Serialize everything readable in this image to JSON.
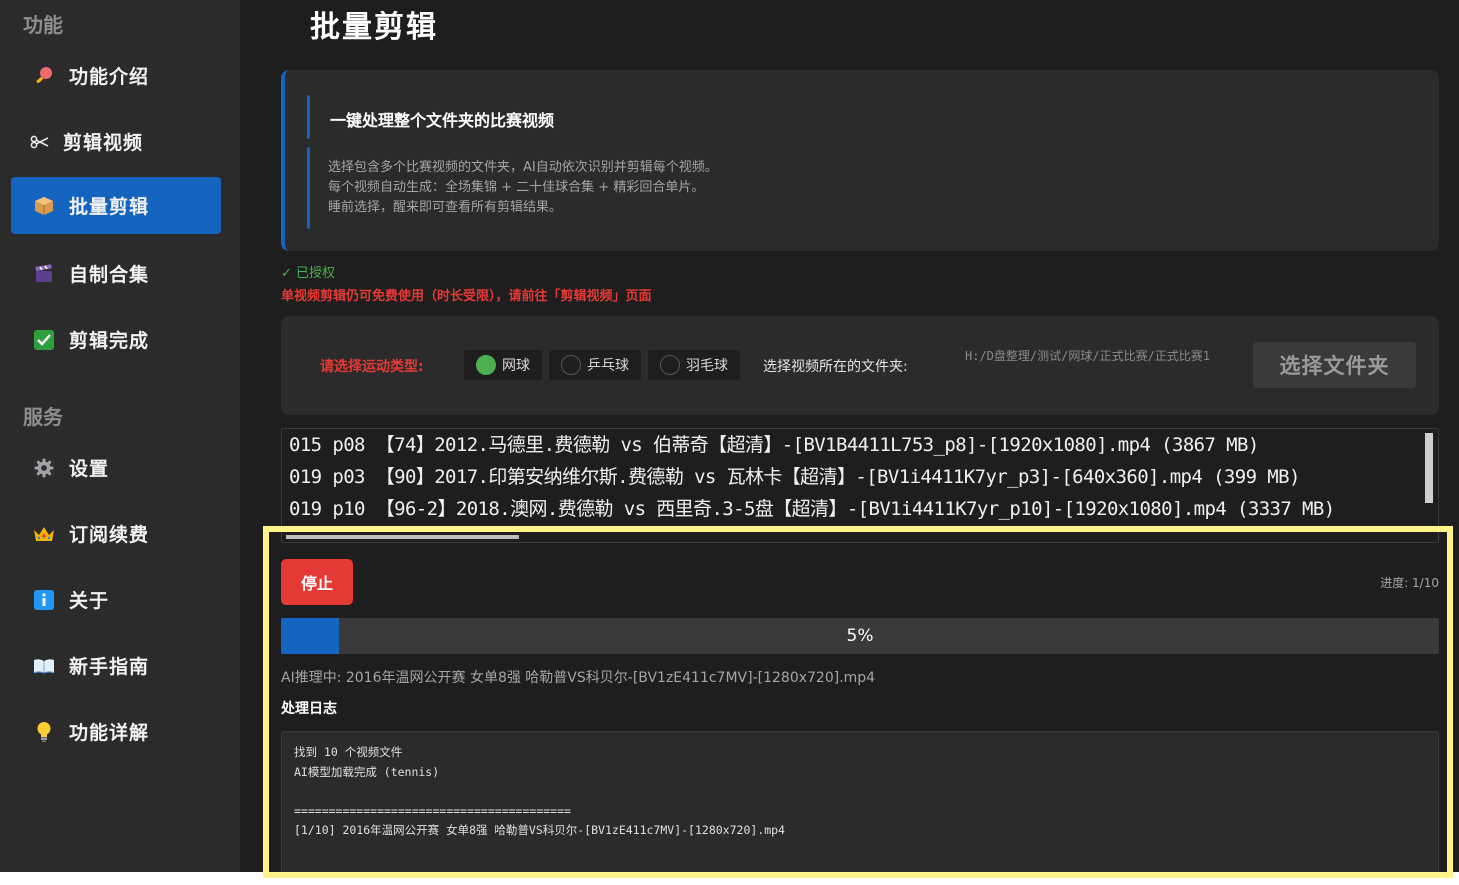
{
  "sidebar": {
    "sections": [
      {
        "title": "功能"
      },
      {
        "title": "服务"
      }
    ],
    "items": [
      {
        "label": "功能介绍",
        "icon": "pin-icon"
      },
      {
        "label": "剪辑视频",
        "icon": "scissors-icon"
      },
      {
        "label": "批量剪辑",
        "icon": "package-icon"
      },
      {
        "label": "自制合集",
        "icon": "clapperboard-icon"
      },
      {
        "label": "剪辑完成",
        "icon": "check-box-icon"
      },
      {
        "label": "设置",
        "icon": "gear-icon"
      },
      {
        "label": "订阅续费",
        "icon": "crown-icon"
      },
      {
        "label": "关于",
        "icon": "info-icon"
      },
      {
        "label": "新手指南",
        "icon": "book-icon"
      },
      {
        "label": "功能详解",
        "icon": "lightbulb-icon"
      }
    ]
  },
  "page": {
    "title": "批量剪辑"
  },
  "intro": {
    "heading": "一键处理整个文件夹的比赛视频",
    "lines": [
      "选择包含多个比赛视频的文件夹，AI自动依次识别并剪辑每个视频。",
      "每个视频自动生成：全场集锦 + 二十佳球合集 + 精彩回合单片。",
      "睡前选择，醒来即可查看所有剪辑结果。"
    ]
  },
  "auth": {
    "status": "✓  已授权",
    "warning": "单视频剪辑仍可免费使用（时长受限），请前往「剪辑视频」页面"
  },
  "options": {
    "sport_label": "请选择运动类型:",
    "sports": [
      {
        "label": "网球",
        "checked": true
      },
      {
        "label": "乒乓球",
        "checked": false
      },
      {
        "label": "羽毛球",
        "checked": false
      }
    ],
    "folder_label": "选择视频所在的文件夹:",
    "folder_path": "H:/D盘整理/测试/网球/正式比赛/正式比赛1",
    "choose_button": "选择文件夹"
  },
  "files": [
    "015 p08 【74】2012.马德里.费德勒 vs 伯蒂奇【超清】-[BV1B4411L753_p8]-[1920x1080].mp4  (3867 MB)",
    "019 p03 【90】2017.印第安纳维尔斯.费德勒 vs 瓦林卡【超清】-[BV1i4411K7yr_p3]-[640x360].mp4  (399 MB)",
    "019 p10 【96-2】2018.澳网.费德勒 vs 西里奇.3-5盘【超清】-[BV1i4411K7yr_p10]-[1920x1080].mp4  (3337 MB)"
  ],
  "progress": {
    "stop_button": "停止",
    "count": "进度: 1/10",
    "percent_text": "5%",
    "fraction": 0.05,
    "inference": "AI推理中: 2016年温网公开赛 女单8强 哈勒普VS科贝尔-[BV1zE411c7MV]-[1280x720].mp4"
  },
  "log": {
    "title": "处理日志",
    "lines": [
      "找到 10 个视频文件",
      "AI模型加载完成 (tennis)",
      "",
      "========================================",
      "[1/10] 2016年温网公开赛 女单8强 哈勒普VS科贝尔-[BV1zE411c7MV]-[1280x720].mp4"
    ]
  },
  "colors": {
    "accent": "#1565c0",
    "danger": "#e53935",
    "success": "#4caf50",
    "highlight": "#fff38a"
  }
}
